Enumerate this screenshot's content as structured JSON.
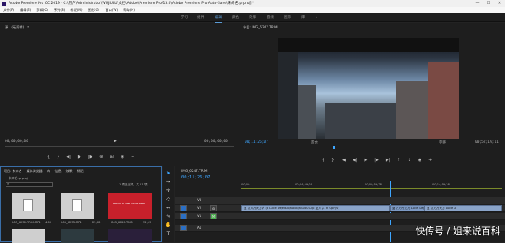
{
  "window": {
    "title": "Adobe Premiere Pro CC 2019 - C:\\用户\\Administrator\\WUJIULU\\文档\\Adobe\\Premiere Pro\\13.0\\Adobe Premiere Pro Auto-Save\\未命名.prproj] *",
    "minimize": "—",
    "maximize": "☐",
    "close": "✕"
  },
  "menu": [
    "文件(F)",
    "编辑(E)",
    "剪辑(C)",
    "序列(S)",
    "标记(M)",
    "图形(G)",
    "窗口(W)",
    "帮助(H)"
  ],
  "workspaces": {
    "items": [
      "学习",
      "组件",
      "编辑",
      "颜色",
      "效果",
      "音频",
      "图形",
      "库"
    ],
    "active": "编辑",
    "more": "»"
  },
  "source_monitor": {
    "tab": "源：(无剪辑)",
    "timecode_left": "00;00;00;00",
    "timecode_right": "00;00;00;00"
  },
  "program_monitor": {
    "tab": "节目: IMG_6247.TRIM",
    "timecode_current": "00;11;26;07",
    "fit": "适合",
    "quality": "完整",
    "timecode_duration": "00;52;19;11"
  },
  "project_panel": {
    "tabs": [
      "项目: 未命名",
      "媒体浏览器",
      "库",
      "信息",
      "效果",
      "标记"
    ],
    "file": "未命名.prproj",
    "selection": "1 项已选择，共 11 项",
    "search_placeholder": "",
    "items": [
      {
        "name": "IMG_6250.TRIM.MP4",
        "duration": "4;00"
      },
      {
        "name": "IMG_6253.MP4",
        "duration": "25;00"
      },
      {
        "name": "IMG_6247.TRIM",
        "duration": "52;19"
      }
    ],
    "thumb_text": "RETRO PLAYER  WHAT BEEN"
  },
  "timeline": {
    "tab": "IMG_6247.TRIM",
    "timecode": "00;11;26;07",
    "ruler": [
      "00;00",
      "00;04;59;29",
      "00;09;59;28",
      "00;14;59;28"
    ],
    "tracks": [
      "V3",
      "V2",
      "V1",
      "A1"
    ],
    "clip_v2": "复 万万万天万内 (3 Lucie Dejeduo/Kolon/KS060 Clip 复万  并 申  Uph(V)",
    "clip_v1_end": "复 万万万天万  Lucie Dejeduo",
    "clip_v1_end_b": "复 万万万天万  Lucie D"
  },
  "watermark": "快传号 / 姐来说百科"
}
